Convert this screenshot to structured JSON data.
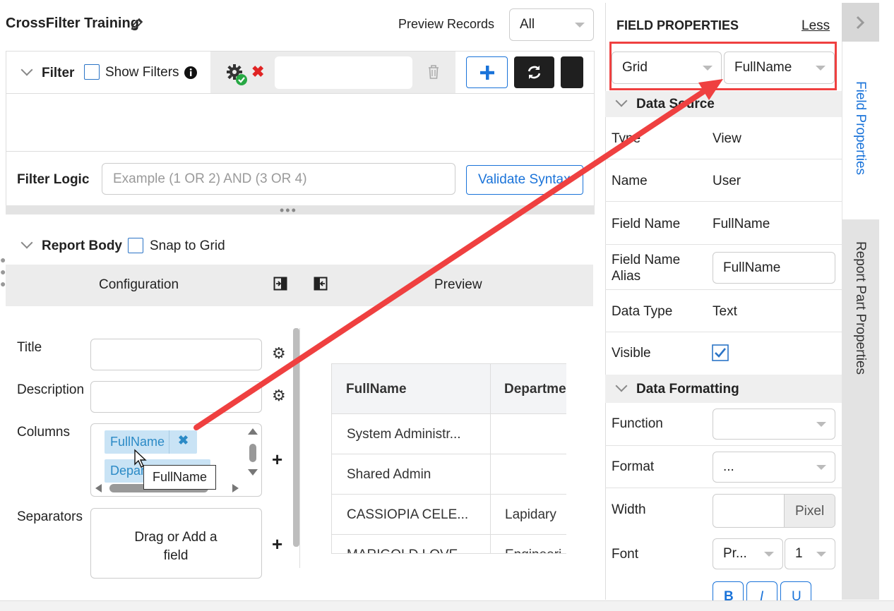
{
  "header": {
    "title": "CrossFilter Training",
    "preview_records_label": "Preview Records",
    "preview_records_value": "All"
  },
  "filter": {
    "label": "Filter",
    "show_filters_label": "Show Filters",
    "logic_label": "Filter Logic",
    "logic_placeholder": "Example (1 OR 2) AND (3 OR 4)",
    "validate_label": "Validate Syntax"
  },
  "report_body": {
    "label": "Report Body",
    "snap_label": "Snap to Grid",
    "config_label": "Configuration",
    "preview_label": "Preview"
  },
  "config": {
    "title_label": "Title",
    "description_label": "Description",
    "columns_label": "Columns",
    "column_chip_1": "FullName",
    "column_chip_2": "Depar",
    "tooltip": "FullName",
    "separators_label": "Separators",
    "drag_add_label": "Drag or Add a field"
  },
  "preview_table": {
    "headers": [
      "FullName",
      "Departme"
    ],
    "rows": [
      [
        "System Administr...",
        ""
      ],
      [
        "Shared Admin",
        ""
      ],
      [
        "CASSIOPIA CELE...",
        "Lapidary"
      ],
      [
        "MARIGOLD LOVE...",
        "Engineeri"
      ]
    ]
  },
  "field_properties": {
    "heading": "FIELD PROPERTIES",
    "less_link": "Less",
    "grid_select": "Grid",
    "field_select": "FullName",
    "data_source_label": "Data Source",
    "type_label": "Type",
    "type_value": "View",
    "name_label": "Name",
    "name_value": "User",
    "field_name_label": "Field Name",
    "field_name_value": "FullName",
    "alias_label": "Field Name Alias",
    "alias_value": "FullName",
    "data_type_label": "Data Type",
    "data_type_value": "Text",
    "visible_label": "Visible",
    "visible_checked": true,
    "data_formatting_label": "Data Formatting",
    "function_label": "Function",
    "format_label": "Format",
    "format_value": "...",
    "width_label": "Width",
    "width_unit": "Pixel",
    "font_label": "Font",
    "font_family_value": "Pr...",
    "font_size_value": "1",
    "style_buttons": [
      "B",
      "I",
      "U"
    ]
  },
  "side_tabs": {
    "field_properties": "Field Properties",
    "report_part_properties": "Report Part Properties"
  },
  "colors": {
    "accent": "#1a73d9",
    "annotation": "#ef4040",
    "chip_bg": "#c9e3f5",
    "chip_text": "#2b8ac6"
  }
}
